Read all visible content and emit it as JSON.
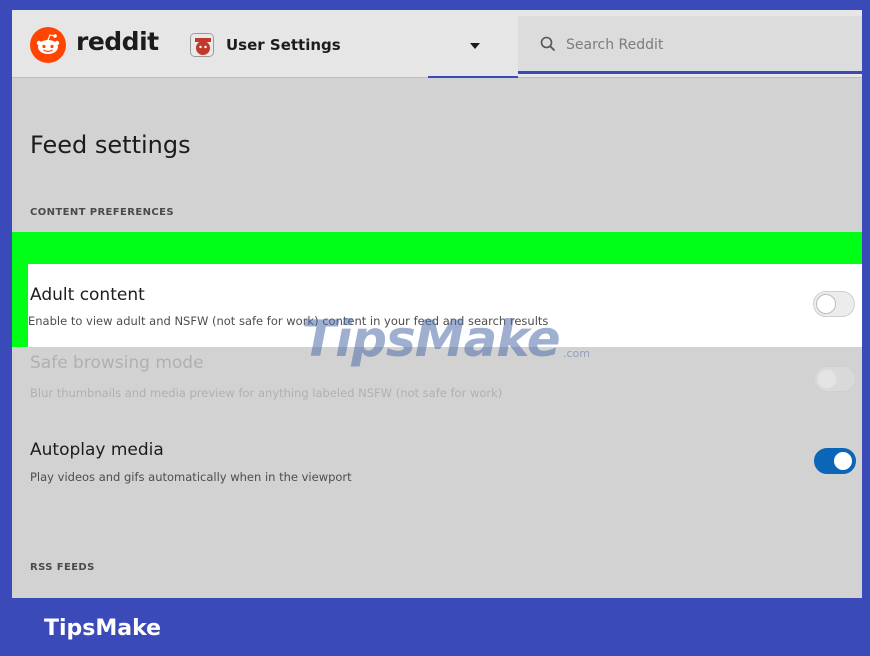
{
  "header": {
    "brand": "reddit",
    "location_label": "User Settings",
    "search": {
      "placeholder": "Search Reddit"
    }
  },
  "page": {
    "title": "Feed settings",
    "sections": [
      {
        "label": "CONTENT PREFERENCES"
      },
      {
        "label": "RSS FEEDS"
      }
    ],
    "settings": [
      {
        "title": "Adult content",
        "description": "Enable to view adult and NSFW (not safe for work) content in your feed and search results",
        "enabled": false
      },
      {
        "title": "Safe browsing mode",
        "description": "Blur thumbnails and media preview for anything labeled NSFW (not safe for work)",
        "enabled": false
      },
      {
        "title": "Autoplay media",
        "description": "Play videos and gifs automatically when in the viewport",
        "enabled": true
      }
    ]
  },
  "watermark": {
    "text": "TipsMake",
    "suffix": ".com"
  },
  "footer": {
    "brand": "TipsMake"
  },
  "colors": {
    "frame": "#3a4ab8",
    "highlight": "#00ff16",
    "toggle_on": "#0c66b8",
    "reddit_orange": "#ff4500"
  }
}
